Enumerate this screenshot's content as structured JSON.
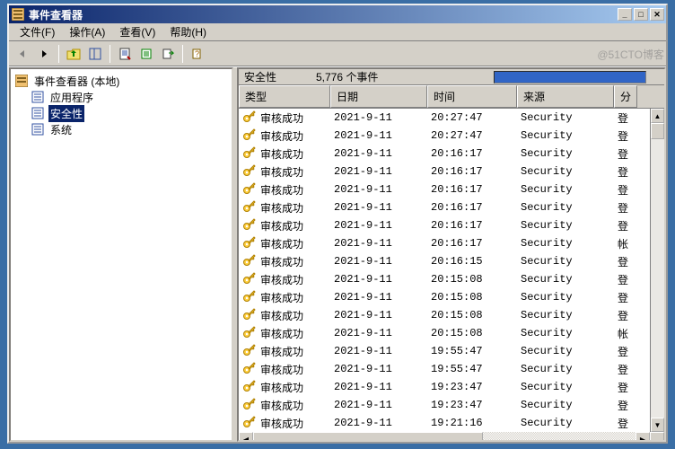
{
  "window": {
    "title": "事件查看器"
  },
  "menus": {
    "file": "文件(F)",
    "action": "操作(A)",
    "view": "查看(V)",
    "help": "帮助(H)"
  },
  "tree": {
    "root": "事件查看器 (本地)",
    "nodes": {
      "app": "应用程序",
      "security": "安全性",
      "system": "系统"
    },
    "selected": "安全性"
  },
  "list_caption": {
    "title": "安全性",
    "count": "5,776  个事件"
  },
  "columns": {
    "type": "类型",
    "date": "日期",
    "time": "时间",
    "source": "来源",
    "category": "分"
  },
  "rows": [
    {
      "type": "审核成功",
      "date": "2021-9-11",
      "time": "20:27:47",
      "source": "Security",
      "cat": "登"
    },
    {
      "type": "审核成功",
      "date": "2021-9-11",
      "time": "20:27:47",
      "source": "Security",
      "cat": "登"
    },
    {
      "type": "审核成功",
      "date": "2021-9-11",
      "time": "20:16:17",
      "source": "Security",
      "cat": "登"
    },
    {
      "type": "审核成功",
      "date": "2021-9-11",
      "time": "20:16:17",
      "source": "Security",
      "cat": "登"
    },
    {
      "type": "审核成功",
      "date": "2021-9-11",
      "time": "20:16:17",
      "source": "Security",
      "cat": "登"
    },
    {
      "type": "审核成功",
      "date": "2021-9-11",
      "time": "20:16:17",
      "source": "Security",
      "cat": "登"
    },
    {
      "type": "审核成功",
      "date": "2021-9-11",
      "time": "20:16:17",
      "source": "Security",
      "cat": "登"
    },
    {
      "type": "审核成功",
      "date": "2021-9-11",
      "time": "20:16:17",
      "source": "Security",
      "cat": "帐"
    },
    {
      "type": "审核成功",
      "date": "2021-9-11",
      "time": "20:16:15",
      "source": "Security",
      "cat": "登"
    },
    {
      "type": "审核成功",
      "date": "2021-9-11",
      "time": "20:15:08",
      "source": "Security",
      "cat": "登"
    },
    {
      "type": "审核成功",
      "date": "2021-9-11",
      "time": "20:15:08",
      "source": "Security",
      "cat": "登"
    },
    {
      "type": "审核成功",
      "date": "2021-9-11",
      "time": "20:15:08",
      "source": "Security",
      "cat": "登"
    },
    {
      "type": "审核成功",
      "date": "2021-9-11",
      "time": "20:15:08",
      "source": "Security",
      "cat": "帐"
    },
    {
      "type": "审核成功",
      "date": "2021-9-11",
      "time": "19:55:47",
      "source": "Security",
      "cat": "登"
    },
    {
      "type": "审核成功",
      "date": "2021-9-11",
      "time": "19:55:47",
      "source": "Security",
      "cat": "登"
    },
    {
      "type": "审核成功",
      "date": "2021-9-11",
      "time": "19:23:47",
      "source": "Security",
      "cat": "登"
    },
    {
      "type": "审核成功",
      "date": "2021-9-11",
      "time": "19:23:47",
      "source": "Security",
      "cat": "登"
    },
    {
      "type": "审核成功",
      "date": "2021-9-11",
      "time": "19:21:16",
      "source": "Security",
      "cat": "登"
    }
  ],
  "watermark": "@51CTO博客"
}
